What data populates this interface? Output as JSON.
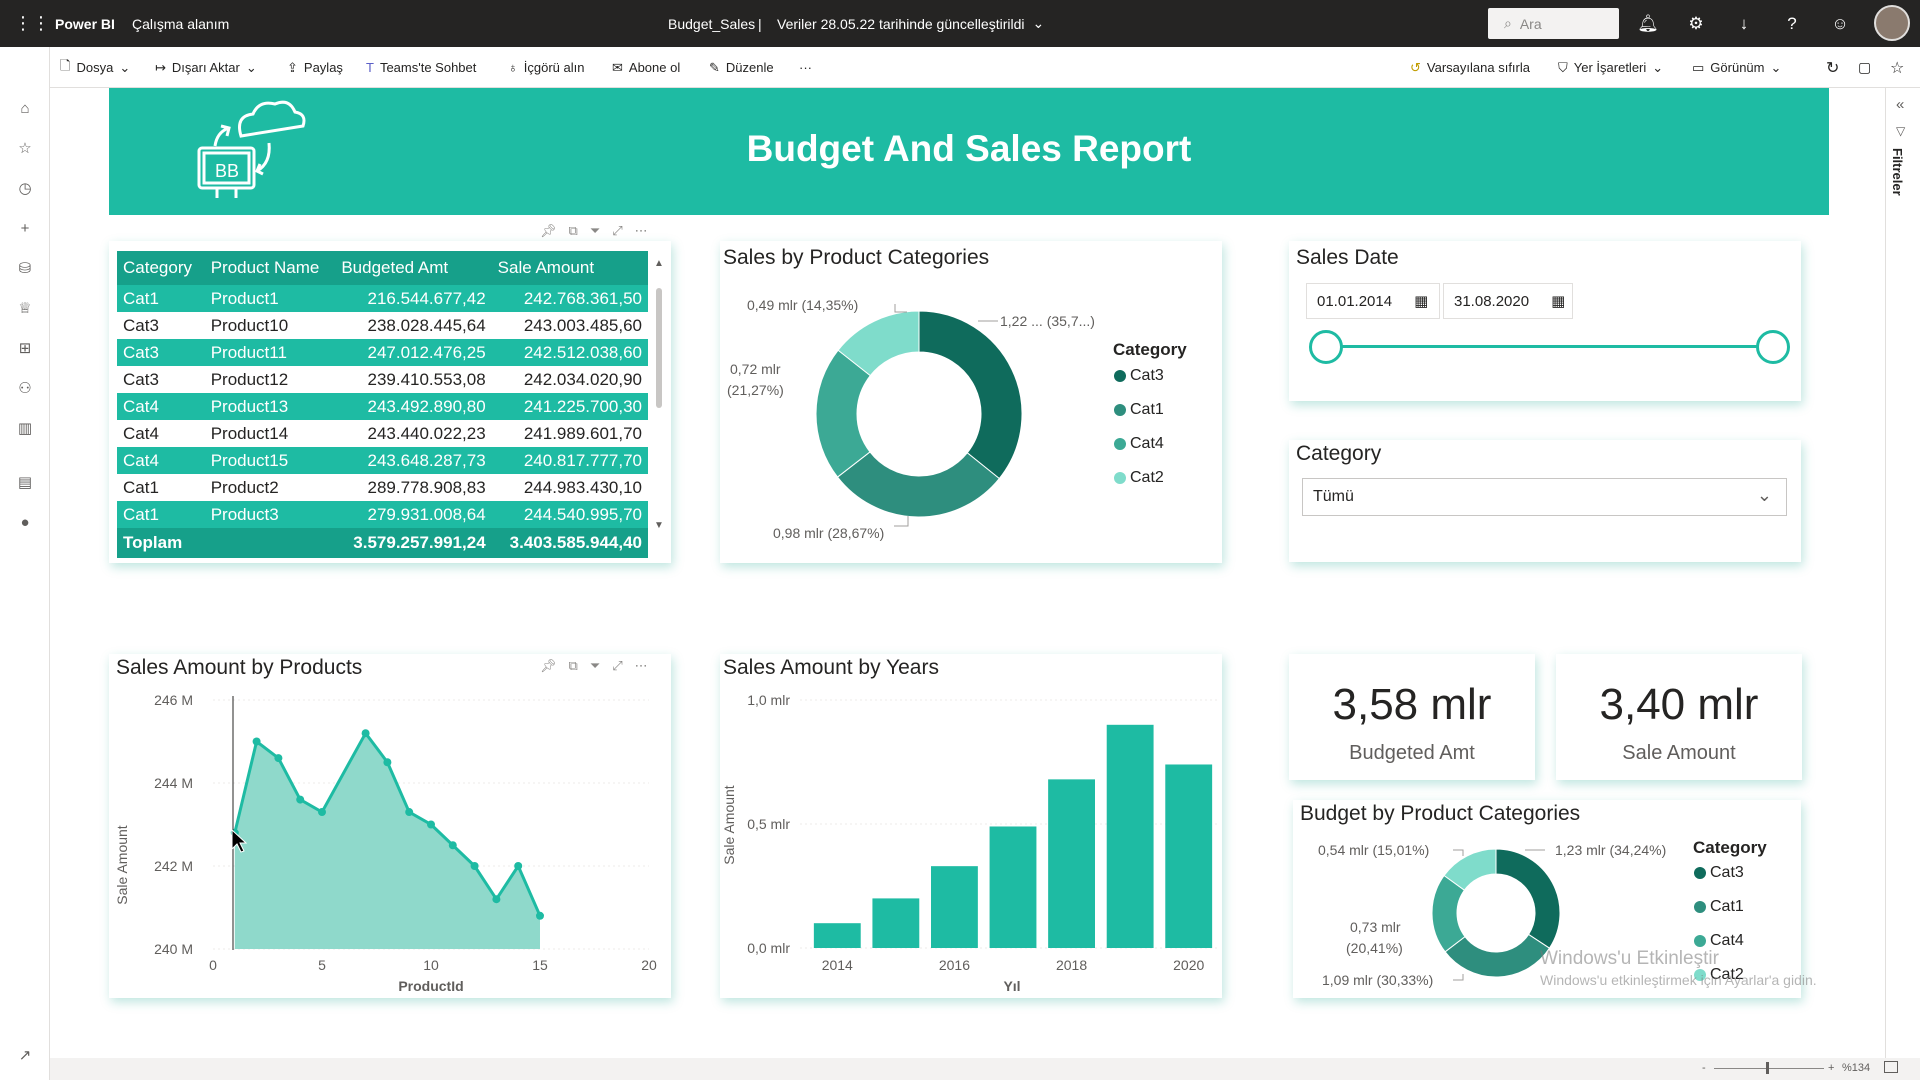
{
  "topbar": {
    "app": "Power BI",
    "workspace": "Çalışma alanım",
    "report_name": "Budget_Sales",
    "separator": "|",
    "updated": "Veriler 28.05.22 tarihinde güncelleştirildi",
    "search_placeholder": "Ara"
  },
  "cmdbar": {
    "file": "Dosya",
    "export": "Dışarı Aktar",
    "share": "Paylaş",
    "teams": "Teams'te Sohbet",
    "insights": "İçgörü alın",
    "subscribe": "Abone ol",
    "edit": "Düzenle",
    "more": "···",
    "reset": "Varsayılana sıfırla",
    "bookmarks": "Yer İşaretleri",
    "view": "Görünüm"
  },
  "filters_pane_label": "Filtreler",
  "banner": {
    "logo_text": "BB",
    "title": "Budget And Sales Report",
    "color": "#1ebba3"
  },
  "table": {
    "headers": [
      "Category",
      "Product Name",
      "Budgeted Amt",
      "Sale Amount"
    ],
    "rows": [
      [
        "Cat1",
        "Product1",
        "216.544.677,42",
        "242.768.361,50"
      ],
      [
        "Cat3",
        "Product10",
        "238.028.445,64",
        "243.003.485,60"
      ],
      [
        "Cat3",
        "Product11",
        "247.012.476,25",
        "242.512.038,60"
      ],
      [
        "Cat3",
        "Product12",
        "239.410.553,08",
        "242.034.020,90"
      ],
      [
        "Cat4",
        "Product13",
        "243.492.890,80",
        "241.225.700,30"
      ],
      [
        "Cat4",
        "Product14",
        "243.440.022,23",
        "241.989.601,70"
      ],
      [
        "Cat4",
        "Product15",
        "243.648.287,73",
        "240.817.777,70"
      ],
      [
        "Cat1",
        "Product2",
        "289.778.908,83",
        "244.983.430,10"
      ],
      [
        "Cat1",
        "Product3",
        "279.931.008,64",
        "244.540.995,70"
      ]
    ],
    "total": [
      "Toplam",
      "",
      "3.579.257.991,24",
      "3.403.585.944,40"
    ]
  },
  "sales_donut": {
    "title": "Sales by Product Categories",
    "legend_title": "Category",
    "labels": [
      "1,22 ... (35,7...)",
      "0,98 mlr (28,67%)",
      "0,72 mlr\n(21,27%)",
      "0,49 mlr (14,35%)"
    ],
    "label_a": "1,22 ... (35,7...)",
    "label_b": "0,98 mlr (28,67%)",
    "label_c1": "0,72 mlr",
    "label_c2": "(21,27%)",
    "label_d": "0,49 mlr (14,35%)"
  },
  "legend_items": [
    "Cat3",
    "Cat1",
    "Cat4",
    "Cat2"
  ],
  "colors": {
    "Cat3": "#0f6b5c",
    "Cat1": "#2e8e7e",
    "Cat4": "#3ca995",
    "Cat2": "#7fdccb",
    "accent": "#1ebba3"
  },
  "sales_date": {
    "title": "Sales Date",
    "start": "01.01.2014",
    "end": "31.08.2020"
  },
  "category_slicer": {
    "title": "Category",
    "selected": "Tümü"
  },
  "area_chart": {
    "title": "Sales Amount by Products",
    "ylabel": "Sale Amount",
    "xlabel": "ProductId",
    "yticks": [
      "246 M",
      "244 M",
      "242 M",
      "240 M"
    ],
    "xticks": [
      "0",
      "5",
      "10",
      "15",
      "20"
    ]
  },
  "bar_chart": {
    "title": "Sales Amount by Years",
    "ylabel": "Sale Amount",
    "xlabel": "Yıl",
    "yticks": [
      "1,0 mlr",
      "0,5 mlr",
      "0,0 mlr"
    ],
    "xticks": [
      "2014",
      "2016",
      "2018",
      "2020"
    ]
  },
  "kpi": {
    "budget_value": "3,58 mlr",
    "budget_label": "Budgeted Amt",
    "sale_value": "3,40 mlr",
    "sale_label": "Sale Amount"
  },
  "budget_donut": {
    "title": "Budget by Product Categories",
    "legend_title": "Category",
    "label_a": "1,23 mlr (34,24%)",
    "label_b": "1,09 mlr (30,33%)",
    "label_c1": "0,73 mlr",
    "label_c2": "(20,41%)",
    "label_d": "0,54 mlr (15,01%)"
  },
  "watermark": {
    "line1": "Windows'u Etkinleştir",
    "line2": "Windows'u etkinleştirmek için Ayarlar'a gidin."
  },
  "status": {
    "zoom": "%134"
  },
  "chart_data": [
    {
      "type": "pie",
      "title": "Sales by Product Categories",
      "categories": [
        "Cat3",
        "Cat1",
        "Cat4",
        "Cat2"
      ],
      "values": [
        1.22,
        0.98,
        0.72,
        0.49
      ],
      "percent": [
        35.7,
        28.67,
        21.27,
        14.35
      ],
      "legend": "right"
    },
    {
      "type": "area",
      "title": "Sales Amount by Products",
      "xlabel": "ProductId",
      "ylabel": "Sale Amount",
      "x": [
        1,
        2,
        3,
        4,
        5,
        7,
        8,
        9,
        10,
        11,
        12,
        13,
        14,
        15
      ],
      "values": [
        242.8,
        245.0,
        244.6,
        243.6,
        243.3,
        245.2,
        244.5,
        243.3,
        243.0,
        242.5,
        242.0,
        241.2,
        242.0,
        240.8
      ],
      "ylim": [
        240,
        246
      ],
      "xlim": [
        0,
        20
      ]
    },
    {
      "type": "bar",
      "title": "Sales Amount by Years",
      "xlabel": "Yıl",
      "ylabel": "Sale Amount",
      "categories": [
        "2014",
        "2015",
        "2016",
        "2017",
        "2018",
        "2019",
        "2020"
      ],
      "values": [
        0.1,
        0.2,
        0.33,
        0.49,
        0.68,
        0.9,
        0.74
      ],
      "ylim": [
        0,
        1.0
      ]
    },
    {
      "type": "pie",
      "title": "Budget by Product Categories",
      "categories": [
        "Cat3",
        "Cat1",
        "Cat4",
        "Cat2"
      ],
      "values": [
        1.23,
        1.09,
        0.73,
        0.54
      ],
      "percent": [
        34.24,
        30.33,
        20.41,
        15.01
      ],
      "legend": "right"
    }
  ]
}
